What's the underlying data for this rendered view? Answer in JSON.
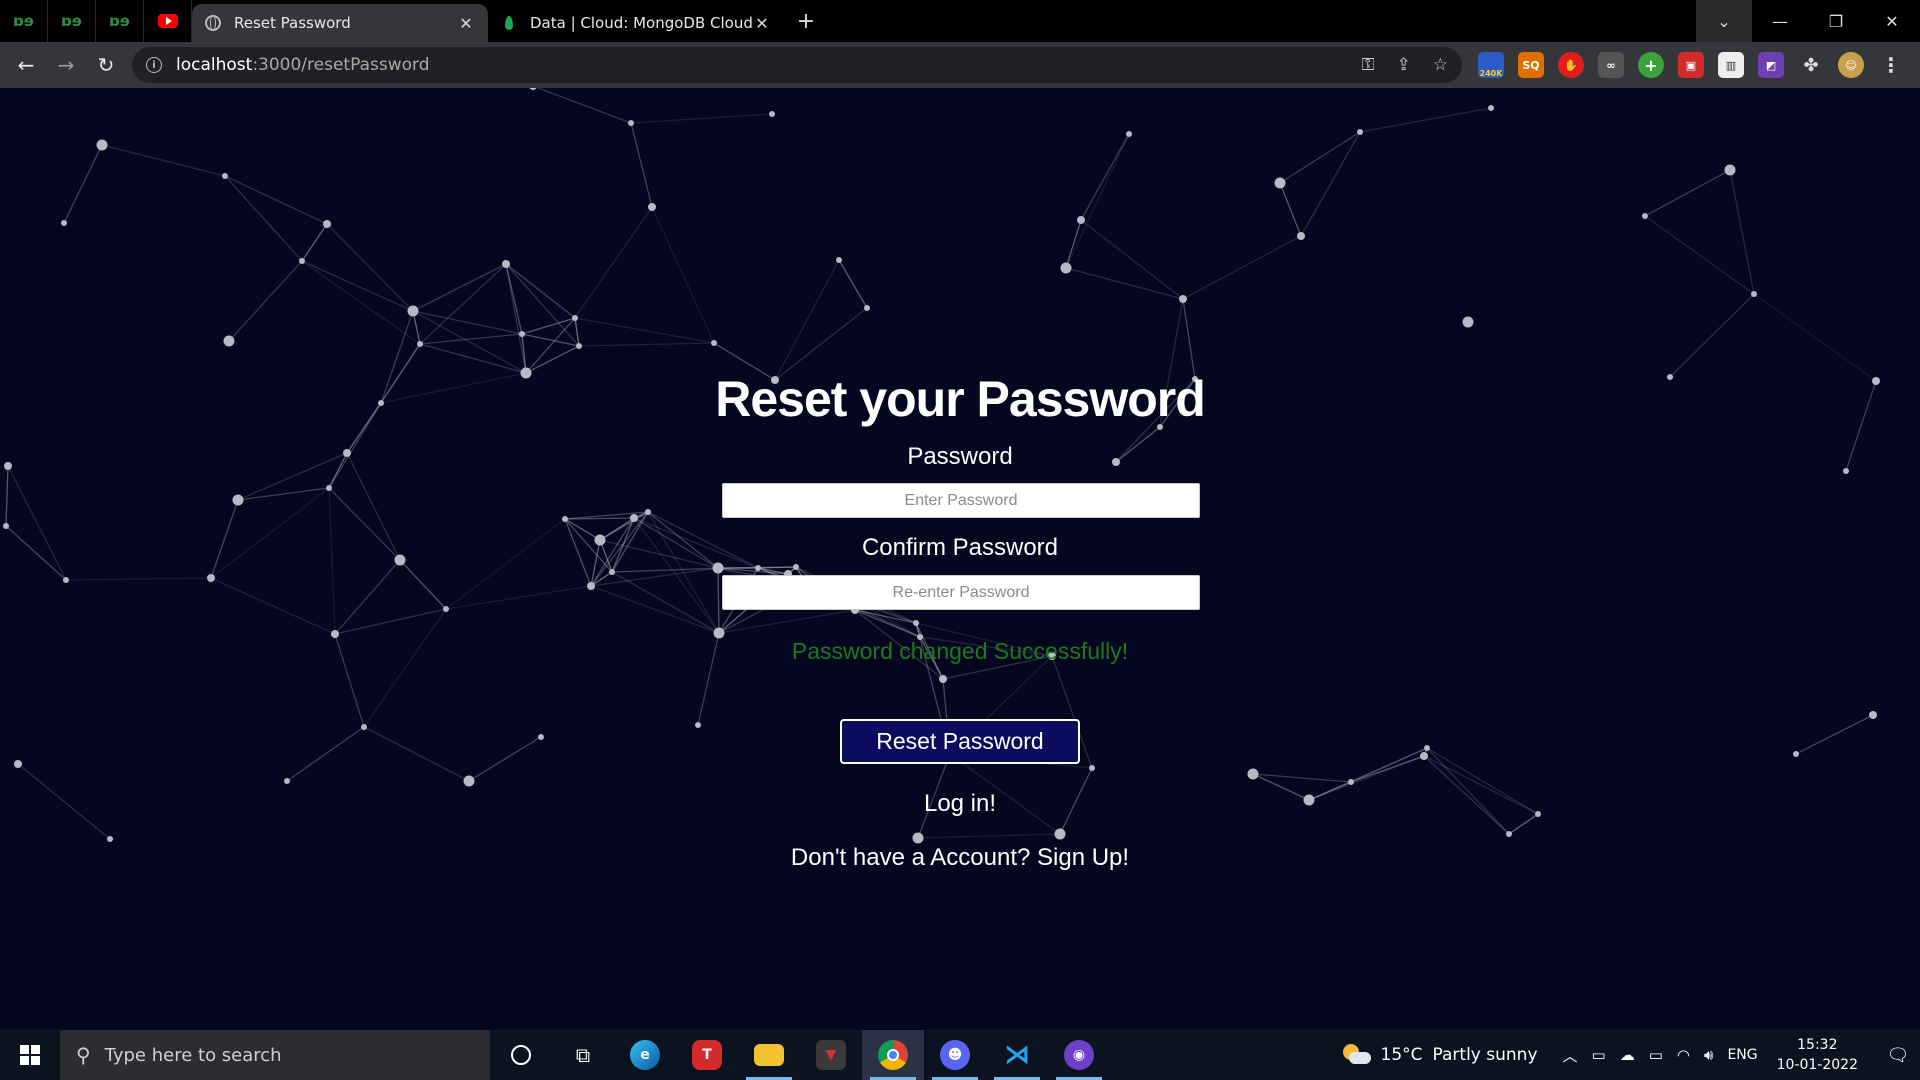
{
  "browser": {
    "pinned_tabs": [
      {
        "icon": "geeksforgeeks-icon",
        "glyph": "ɒɘ"
      },
      {
        "icon": "geeksforgeeks-icon",
        "glyph": "ɒɘ"
      },
      {
        "icon": "geeksforgeeks-icon",
        "glyph": "ɒɘ"
      },
      {
        "icon": "youtube-icon"
      }
    ],
    "tabs": [
      {
        "title": "Reset Password",
        "icon": "globe-icon",
        "active": true
      },
      {
        "title": "Data | Cloud: MongoDB Cloud",
        "icon": "mongodb-leaf-icon",
        "active": false
      }
    ],
    "url_host": "localhost",
    "url_path": ":3000/resetPassword",
    "extension_badge": "240K",
    "extension_sq": "SQ"
  },
  "page": {
    "heading": "Reset your Password",
    "password_label": "Password",
    "password_placeholder": "Enter Password",
    "confirm_label": "Confirm Password",
    "confirm_placeholder": "Re-enter Password",
    "success_message": "Password changed Successfully!",
    "reset_button": "Reset Password",
    "login_link": "Log in!",
    "signup_link": "Don't have a Account? Sign Up!",
    "colors": {
      "background": "#05061f",
      "success": "#1b7b1b",
      "button": "#0b0c5e"
    }
  },
  "taskbar": {
    "search_placeholder": "Type here to search",
    "weather_temp": "15°C",
    "weather_text": "Partly sunny",
    "language": "ENG",
    "time": "15:32",
    "date": "10-01-2022",
    "app_t_letter": "T"
  }
}
